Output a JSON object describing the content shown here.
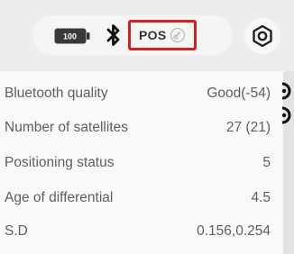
{
  "statusbar": {
    "battery_label": "100",
    "bluetooth_icon": "bluetooth-icon",
    "pos_label": "POS",
    "pos_icon": "satellite-icon",
    "settings_icon": "gear-icon",
    "highlight_color": "#d32020"
  },
  "info_rows": [
    {
      "label": "Bluetooth quality",
      "value": "Good(-54)"
    },
    {
      "label": "Number of satellites",
      "value": "27 (21)"
    },
    {
      "label": "Positioning status",
      "value": "5"
    },
    {
      "label": "Age of differential",
      "value": "4.5"
    },
    {
      "label": "S.D",
      "value": "0.156,0.254"
    }
  ]
}
